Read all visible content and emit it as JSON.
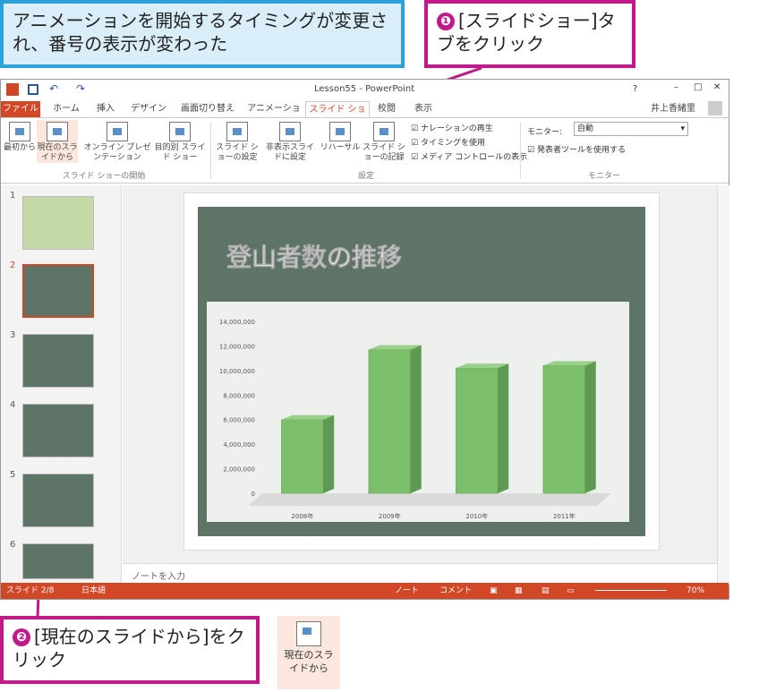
{
  "callouts": {
    "top_left": "アニメーションを開始するタイミングが変更され、番号の表示が変わった",
    "step1_num": "❶",
    "step1_text": "[スライドショー]タブをクリック",
    "step2_num": "❷",
    "step2_text": "[現在のスライドから]をクリック",
    "sample_btn": "現在のスライドから"
  },
  "window": {
    "title": "Lesson55 - PowerPoint",
    "user": "井上香緒里",
    "help": "?",
    "tabs": [
      "ファイル",
      "ホーム",
      "挿入",
      "デザイン",
      "画面切り替え",
      "アニメーション",
      "スライド ショー",
      "校閲",
      "表示"
    ],
    "active_tab": "スライド ショー"
  },
  "ribbon": {
    "from_start": "最初から",
    "from_current": "現在のスライドから",
    "online": "オンライン プレゼンテーション",
    "custom": "目的別 スライド ショー",
    "group1": "スライド ショーの開始",
    "setup": "スライド ショーの設定",
    "hide": "非表示スライドに設定",
    "rehearse": "リハーサル",
    "record": "スライド ショーの記録",
    "chk_narration": "ナレーションの再生",
    "chk_timing": "タイミングを使用",
    "chk_media": "メディア コントロールの表示",
    "group2": "設定",
    "monitor_label": "モニター:",
    "monitor_value": "自動",
    "presenter": "発表者ツールを使用する",
    "group3": "モニター"
  },
  "thumbs": [
    "1",
    "2",
    "3",
    "4",
    "5",
    "6"
  ],
  "slide": {
    "title": "登山者数の推移"
  },
  "notes_placeholder": "ノートを入力",
  "status": {
    "slide": "スライド 2/8",
    "lang": "日本語",
    "notes": "ノート",
    "comments": "コメント",
    "zoom": "70%"
  },
  "chart_data": {
    "type": "bar",
    "categories": [
      "2008年",
      "2009年",
      "2010年",
      "2011年"
    ],
    "values": [
      6000000,
      11700000,
      10200000,
      10400000
    ],
    "ylim": [
      0,
      14000000
    ],
    "yticks": [
      "14,000,000",
      "12,000,000",
      "10,000,000",
      "8,000,000",
      "6,000,000",
      "4,000,000",
      "2,000,000",
      "0"
    ],
    "bar_color": "#7cbf6a"
  }
}
